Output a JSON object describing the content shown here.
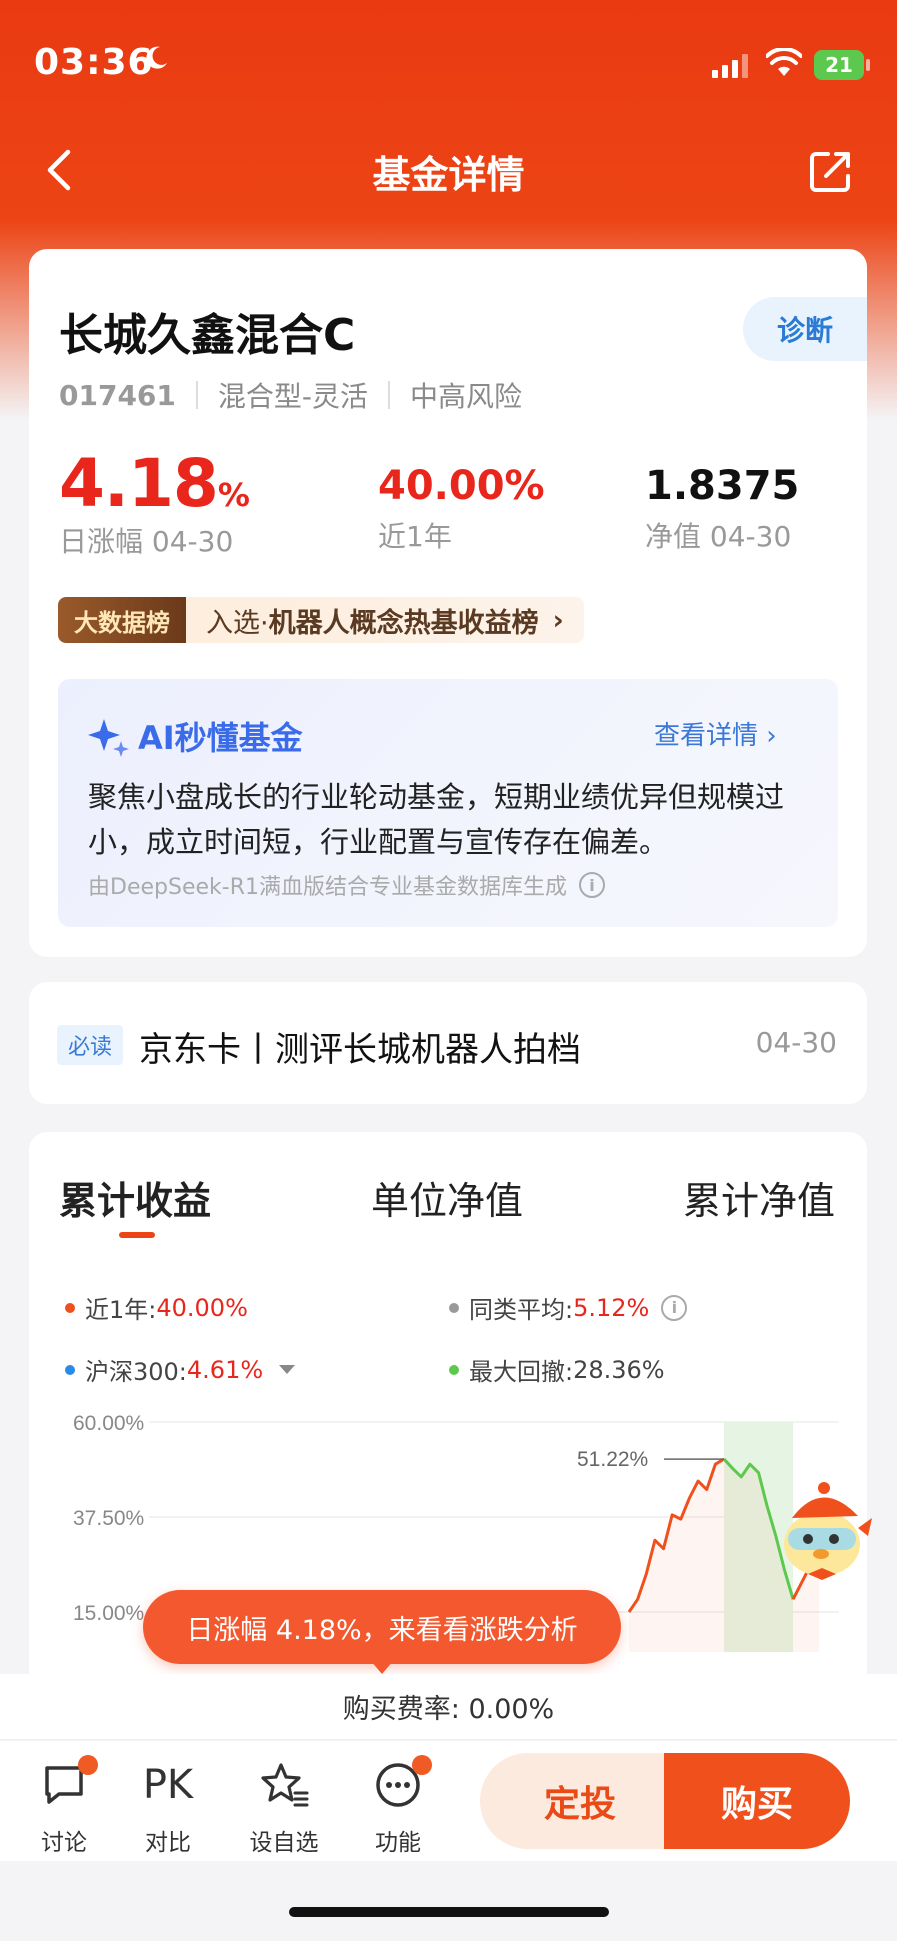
{
  "status_bar": {
    "time": "03:36",
    "battery": "21"
  },
  "nav": {
    "title": "基金详情"
  },
  "fund": {
    "name": "长城久鑫混合C",
    "diagnose_label": "诊断",
    "code": "017461",
    "type": "混合型-灵活",
    "risk": "中高风险",
    "daily_change_value": "4.18",
    "daily_change_unit": "%",
    "daily_change_label": "日涨幅 04-30",
    "year_return": "40.00%",
    "year_return_label": "近1年",
    "nav_value": "1.8375",
    "nav_label": "净值 04-30"
  },
  "ranking": {
    "badge": "大数据榜",
    "prefix": "入选·",
    "name": "机器人概念热基收益榜",
    "arrow": "›"
  },
  "ai": {
    "title": "AI秒懂基金",
    "more": "查看详情 ›",
    "summary": "聚焦小盘成长的行业轮动基金，短期业绩优异但规模过小，成立时间短，行业配置与宣传存在偏差。",
    "source": "由DeepSeek-R1满血版结合专业基金数据库生成"
  },
  "news": {
    "tag": "必读",
    "title": "京东卡丨测评长城机器人拍档",
    "date": "04-30"
  },
  "chart_tabs": {
    "tab1": "累计收益",
    "tab2": "单位净值",
    "tab3": "累计净值"
  },
  "chart_legend": {
    "fund_label": "近1年:",
    "fund_value": "40.00%",
    "peer_label": "同类平均:",
    "peer_value": "5.12%",
    "index_label": "沪深300:",
    "index_value": "4.61%",
    "drawdown_label": "最大回撤:",
    "drawdown_value": "28.36%"
  },
  "chart_data": {
    "type": "line",
    "y_ticks": [
      "60.00%",
      "37.50%",
      "15.00%"
    ],
    "ylim": [
      15,
      60
    ],
    "peak_label": "51.22%",
    "series": [
      {
        "name": "近1年",
        "values": [
          15,
          18,
          24,
          32,
          30,
          38,
          37,
          42,
          46,
          44,
          50,
          51.22,
          49,
          47,
          50,
          48,
          40,
          33,
          25,
          18,
          22,
          26,
          30
        ]
      }
    ]
  },
  "bubble": {
    "text": "日涨幅 4.18%，来看看涨跌分析"
  },
  "fee": {
    "text": "购买费率: 0.00%"
  },
  "bottom_nav": {
    "discuss": "讨论",
    "pk_icon": "PK",
    "compare": "对比",
    "watch": "设自选",
    "function": "功能",
    "invest_button": "定投",
    "buy_button": "购买"
  },
  "colors": {
    "brand": "#ec4415",
    "rise": "#e8261c",
    "ai_blue": "#3a6be8"
  }
}
